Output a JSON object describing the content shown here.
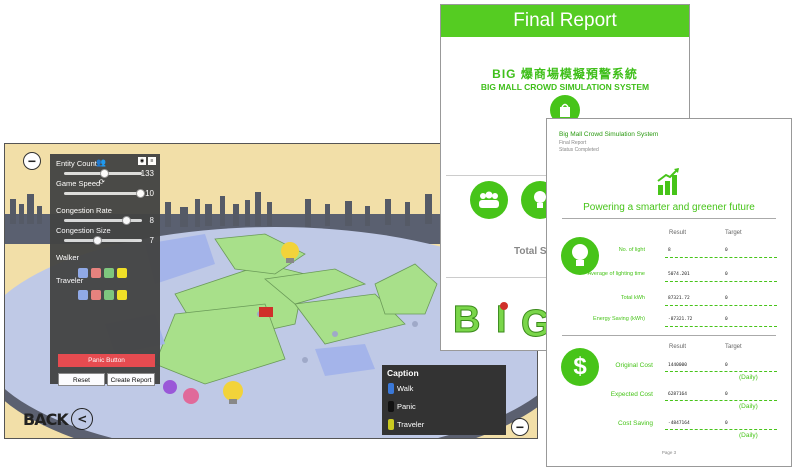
{
  "simulation": {
    "panel": {
      "entity_count_label": "Entity Count",
      "entity_count_value": "133",
      "entity_count_level": 0.5,
      "game_speed_label": "Game Speed",
      "game_speed_value": "10",
      "game_speed_level": 1.0,
      "congestion_rate_label": "Congestion Rate",
      "congestion_rate_value": "8",
      "congestion_rate_level": 0.8,
      "congestion_size_label": "Congestion Size",
      "congestion_size_value": "7",
      "congestion_size_level": 0.4,
      "walker_label": "Walker",
      "traveler_label": "Traveler",
      "walker_colors": [
        "#8fa8e8",
        "#e8807a",
        "#7cc67a",
        "#f2e020"
      ],
      "traveler_colors": [
        "#8fa8e8",
        "#e8807a",
        "#7cc67a",
        "#f2e020"
      ],
      "panic_button": "Panic Button",
      "reset_button": "Reset",
      "create_report_button": "Create Report"
    },
    "caption": {
      "title": "Caption",
      "items": [
        "Walk",
        "Panic",
        "Traveler"
      ],
      "colors": [
        "#3a78d8",
        "#111111",
        "#c8c820"
      ]
    },
    "back_label": "BACK",
    "collapse_symbol": "−",
    "colors": {
      "sand": "#f2dfa8",
      "mall_floor": "#a8e08a",
      "walkway": "#c9d4f0",
      "panel_bg": "#444444"
    }
  },
  "report_cover": {
    "header": "Final Report",
    "title_cn": "BIG 爆商場模擬預警系統",
    "title_en": "BIG MALL CROWD SIMULATION SYSTEM",
    "total_label": "Total S",
    "logo_letters": [
      "B",
      "I",
      "G"
    ],
    "accent_color": "#55cc22"
  },
  "report_page": {
    "system_title": "Big Mall Crowd Simulation System",
    "subtitle": "Final Report",
    "status": "Status Completed",
    "slogan": "Powering a smarter and greener future",
    "result_header": "Result",
    "target_header": "Target",
    "light_rows": [
      {
        "label": "No. of light",
        "result": "8",
        "target": "0"
      },
      {
        "label": "Average of lighting time",
        "result": "5074.201",
        "target": "0"
      },
      {
        "label": "Total kWh",
        "result": "87321.72",
        "target": "0"
      },
      {
        "label": "Energy Saving (kWh)",
        "result": "-87321.72",
        "target": "0"
      }
    ],
    "cost_rows": [
      {
        "label": "Original Cost",
        "result": "1440000",
        "target": "0",
        "unit": "(Daily)"
      },
      {
        "label": "Expected Cost",
        "result": "6287164",
        "target": "0",
        "unit": "(Daily)"
      },
      {
        "label": "Cost Saving",
        "result": "-4847164",
        "target": "0",
        "unit": "(Daily)"
      }
    ],
    "page_number": "Page 3"
  }
}
